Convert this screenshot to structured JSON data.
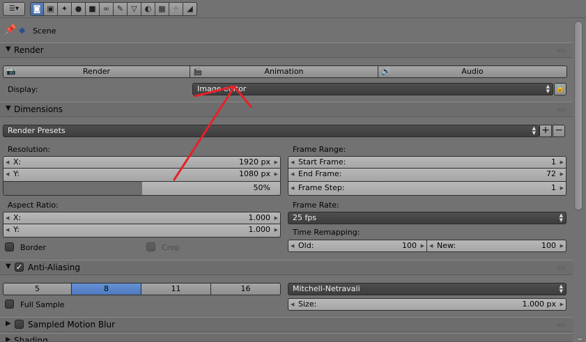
{
  "context": {
    "label": "Scene"
  },
  "render": {
    "title": "Render",
    "buttons": [
      "Render",
      "Animation",
      "Audio"
    ],
    "display_label": "Display:",
    "display_value": "Image editor"
  },
  "dimensions": {
    "title": "Dimensions",
    "presets": "Render Presets",
    "resolution_label": "Resolution:",
    "res_x_label": "X:",
    "res_x": "1920 px",
    "res_y_label": "Y:",
    "res_y": "1080 px",
    "res_percent": "50%",
    "res_percent_value": 0.5,
    "aspect_label": "Aspect Ratio:",
    "aspect_x_label": "X:",
    "aspect_x": "1.000",
    "aspect_y_label": "Y:",
    "aspect_y": "1.000",
    "border_label": "Border",
    "crop_label": "Crop",
    "frame_range_label": "Frame Range:",
    "start_label": "Start Frame:",
    "start": "1",
    "end_label": "End Frame:",
    "end": "72",
    "step_label": "Frame Step:",
    "step": "1",
    "frame_rate_label": "Frame Rate:",
    "frame_rate": "25 fps",
    "time_remap_label": "Time Remapping:",
    "old_label": "Old:",
    "old": "100",
    "new_label": "New:",
    "new": "100"
  },
  "antialiasing": {
    "title": "Anti-Aliasing",
    "samples": [
      "5",
      "8",
      "11",
      "16"
    ],
    "selected_sample": "8",
    "filter": "Mitchell-Netravali",
    "full_sample_label": "Full Sample",
    "size_label": "Size:",
    "size": "1.000 px"
  },
  "motion_blur": {
    "title": "Sampled Motion Blur"
  },
  "shading": {
    "title": "Shading"
  },
  "colors": {
    "accent": "#5680c2",
    "annotation": "#e8202a"
  },
  "toolbar_icons": [
    "render-icon",
    "render-layers-icon",
    "scene-icon",
    "world-icon",
    "object-icon",
    "constraints-icon",
    "modifiers-icon",
    "data-icon",
    "material-icon",
    "texture-icon",
    "particles-icon",
    "physics-icon"
  ]
}
